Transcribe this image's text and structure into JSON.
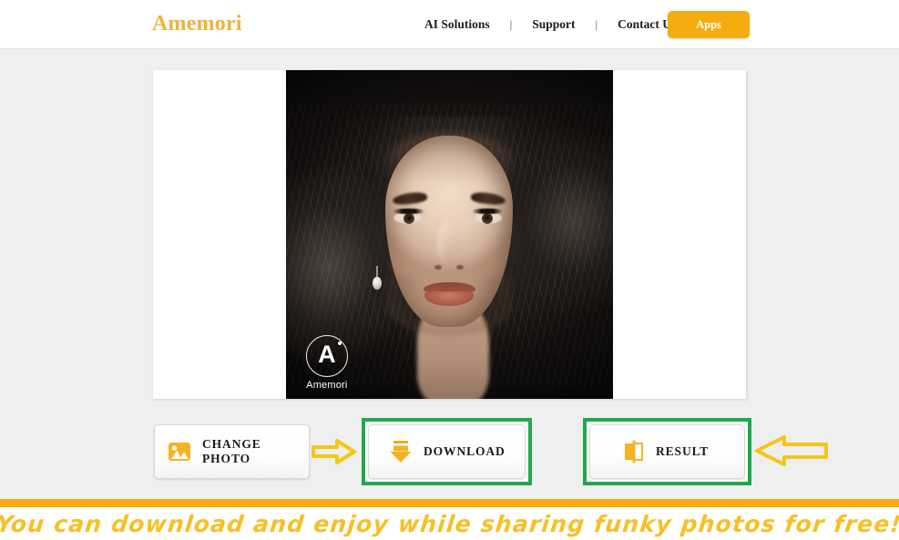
{
  "header": {
    "logo": "Amemori",
    "nav": [
      {
        "label": "AI Solutions"
      },
      {
        "label": "Support"
      },
      {
        "label": "Contact Us"
      }
    ],
    "separator": "|",
    "apps_button": "Apps"
  },
  "photo": {
    "watermark_letter": "A",
    "watermark_text": "Amemori",
    "alt": "portrait of a woman with long dark hair on a dark background"
  },
  "actions": [
    {
      "label": "CHANGE PHOTO",
      "icon": "image-icon",
      "highlighted": false
    },
    {
      "label": "DOWNLOAD",
      "icon": "download-icon",
      "highlighted": true
    },
    {
      "label": "RESULT",
      "icon": "flip-book-icon",
      "highlighted": true
    }
  ],
  "annotations": {
    "arrow_right": "arrow-right-icon",
    "arrow_left": "arrow-left-icon",
    "highlight_color": "#21a84c",
    "arrow_color": "#f5c518"
  },
  "footer": {
    "message": "You can download and enjoy while sharing funky photos for free!"
  },
  "colors": {
    "brand_amber": "#f5ac10",
    "logo_gold": "#efb33c",
    "banner_yellow": "#f7c028",
    "highlight_green": "#21a84c",
    "page_background": "#efefef"
  }
}
